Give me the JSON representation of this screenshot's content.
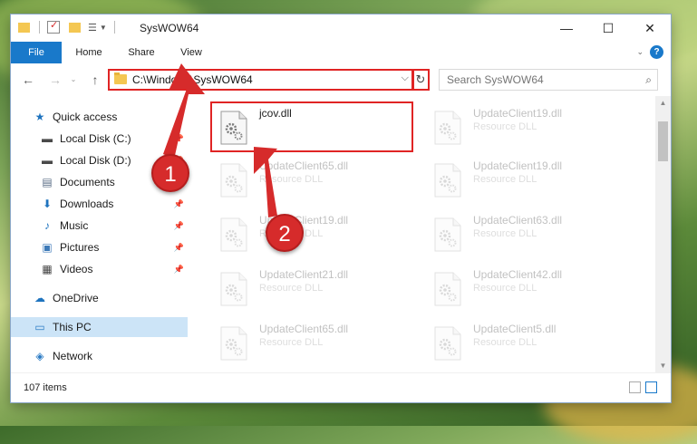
{
  "window": {
    "title": "SysWOW64",
    "controls": {
      "minimize": "—",
      "maximize": "☐",
      "close": "✕"
    }
  },
  "ribbon": {
    "tabs": [
      "File",
      "Home",
      "Share",
      "View"
    ],
    "help": "?"
  },
  "nav": {
    "back": "←",
    "forward": "→",
    "up": "↑",
    "address": "C:\\Windows\\SysWOW64",
    "address_chevron": "⌵",
    "refresh": "↻",
    "search_placeholder": "Search SysWOW64",
    "search_glyph": "⌕"
  },
  "sidebar": {
    "items": [
      {
        "label": "Quick access",
        "icon": "star-icon",
        "glyph": "★",
        "color": "#1e73be"
      },
      {
        "label": "Local Disk (C:)",
        "icon": "drive-icon",
        "glyph": "▬",
        "color": "#4a4a4a",
        "pinned": true
      },
      {
        "label": "Local Disk (D:)",
        "icon": "drive-icon",
        "glyph": "▬",
        "color": "#4a4a4a",
        "pinned": true
      },
      {
        "label": "Documents",
        "icon": "documents-icon",
        "glyph": "▤",
        "color": "#5b6e86",
        "pinned": true
      },
      {
        "label": "Downloads",
        "icon": "download-icon",
        "glyph": "⬇",
        "color": "#1e73be",
        "pinned": true
      },
      {
        "label": "Music",
        "icon": "music-icon",
        "glyph": "♪",
        "color": "#1e73be",
        "pinned": true
      },
      {
        "label": "Pictures",
        "icon": "pictures-icon",
        "glyph": "▣",
        "color": "#3d7ab8",
        "pinned": true
      },
      {
        "label": "Videos",
        "icon": "videos-icon",
        "glyph": "▦",
        "color": "#444",
        "pinned": true
      },
      {
        "label": "OneDrive",
        "icon": "cloud-icon",
        "glyph": "☁",
        "color": "#1e73be"
      },
      {
        "label": "This PC",
        "icon": "computer-icon",
        "glyph": "▭",
        "color": "#2b7bc4",
        "selected": true
      },
      {
        "label": "Network",
        "icon": "network-icon",
        "glyph": "◈",
        "color": "#2b7bc4"
      }
    ],
    "pin_glyph": "📌"
  },
  "files": [
    {
      "name": "jcov.dll",
      "type": "",
      "highlighted": true
    },
    {
      "name": "UpdateClient19.dll",
      "type": "Resource DLL"
    },
    {
      "name": "UpdateClient65.dll",
      "type": "Resource DLL"
    },
    {
      "name": "UpdateClient19.dll",
      "type": "Resource DLL"
    },
    {
      "name": "UpdateClient19.dll",
      "type": "Resource DLL"
    },
    {
      "name": "UpdateClient63.dll",
      "type": "Resource DLL"
    },
    {
      "name": "UpdateClient21.dll",
      "type": "Resource DLL"
    },
    {
      "name": "UpdateClient42.dll",
      "type": "Resource DLL"
    },
    {
      "name": "UpdateClient65.dll",
      "type": "Resource DLL"
    },
    {
      "name": "UpdateClient5.dll",
      "type": "Resource DLL"
    }
  ],
  "status": {
    "items_count": "107 items"
  },
  "callouts": [
    "1",
    "2"
  ],
  "colors": {
    "accent": "#1979ca",
    "highlight": "#e02424",
    "callout": "#d62b2b",
    "selected": "#cce4f7"
  }
}
